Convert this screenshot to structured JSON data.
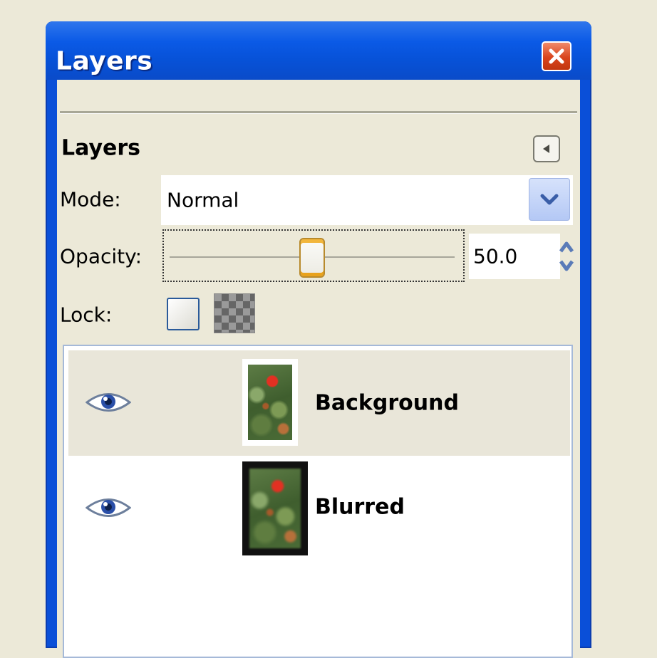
{
  "window": {
    "title": "Layers"
  },
  "panel": {
    "heading": "Layers"
  },
  "mode": {
    "label": "Mode:",
    "value": "Normal"
  },
  "opacity": {
    "label": "Opacity:",
    "value": "50.0",
    "level": 0.5
  },
  "lock": {
    "label": "Lock:"
  },
  "layers": [
    {
      "name": "Background",
      "visible": true,
      "selected": true
    },
    {
      "name": "Blurred",
      "visible": true,
      "selected": false
    }
  ],
  "colors": {
    "titlebar": "#0a4fd8",
    "close_button": "#d9441c",
    "dialog_bg": "#ece9d8",
    "selected_row": "#e9e6d9",
    "slider_accent": "#f2b63c"
  },
  "icons": {
    "close": "close-icon",
    "panel_menu": "triangle-left-icon",
    "mode_dropdown": "chevron-down-icon",
    "spin_up": "arrow-up-icon",
    "spin_down": "arrow-down-icon",
    "lock_pixels": "lock-pixels-icon",
    "lock_alpha": "lock-alpha-checkerboard-icon",
    "visibility": "eye-icon"
  }
}
